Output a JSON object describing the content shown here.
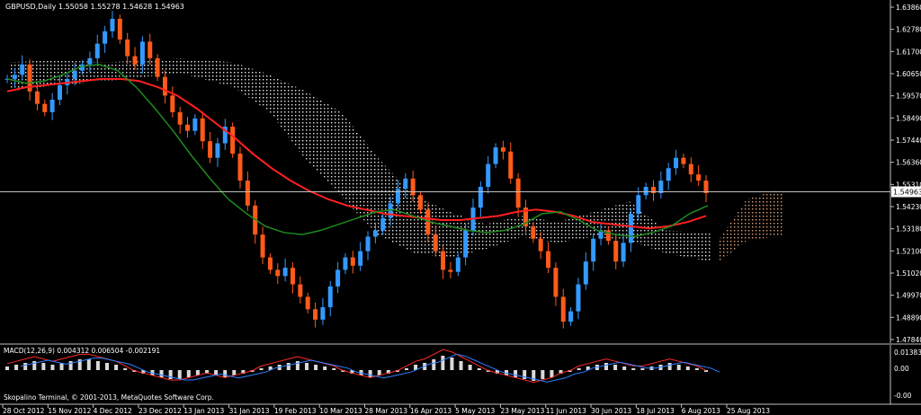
{
  "chart_data": [
    {
      "type": "candlestick",
      "title": "GBPUSD,Daily  1.55058 1.55278 1.54628 1.54963",
      "footer": "Skopalino Terminal, © 2001-2013, MetaQuotes Software Corp.",
      "current_price_label": "1.54963",
      "current_price": 1.54963,
      "ylim": [
        1.4784,
        1.6386
      ],
      "y_ticks": [
        "1.63860",
        "1.62780",
        "1.61700",
        "1.60650",
        "1.59570",
        "1.58490",
        "1.57440",
        "1.56360",
        "1.55310",
        "1.54230",
        "1.53180",
        "1.52100",
        "1.51020",
        "1.49970",
        "1.48890",
        "1.47840"
      ],
      "x_ticks": [
        "28 Oct 2012",
        "15 Nov 2012",
        "4 Dec 2012",
        "23 Dec 2012",
        "13 Jan 2013",
        "31 Jan 2013",
        "19 Feb 2013",
        "10 Mar 2013",
        "28 Mar 2013",
        "16 Apr 2013",
        "5 May 2013",
        "23 May 2013",
        "11 Jun 2013",
        "30 Jun 2013",
        "18 Jul 2013",
        "6 Aug 2013",
        "25 Aug 2013"
      ],
      "close_path": [
        1.604,
        1.606,
        1.611,
        1.598,
        1.592,
        1.588,
        1.594,
        1.601,
        1.604,
        1.608,
        1.611,
        1.614,
        1.621,
        1.627,
        1.633,
        1.623,
        1.615,
        1.611,
        1.622,
        1.614,
        1.605,
        1.596,
        1.588,
        1.582,
        1.579,
        1.585,
        1.574,
        1.566,
        1.573,
        1.581,
        1.568,
        1.555,
        1.543,
        1.529,
        1.518,
        1.512,
        1.509,
        1.513,
        1.505,
        1.499,
        1.493,
        1.488,
        1.494,
        1.504,
        1.512,
        1.518,
        1.514,
        1.521,
        1.528,
        1.531,
        1.537,
        1.544,
        1.551,
        1.556,
        1.548,
        1.541,
        1.529,
        1.521,
        1.512,
        1.511,
        1.518,
        1.531,
        1.542,
        1.552,
        1.563,
        1.571,
        1.569,
        1.556,
        1.542,
        1.533,
        1.527,
        1.521,
        1.513,
        1.499,
        1.487,
        1.492,
        1.505,
        1.516,
        1.527,
        1.531,
        1.526,
        1.516,
        1.525,
        1.539,
        1.548,
        1.552,
        1.549,
        1.555,
        1.561,
        1.566,
        1.563,
        1.558,
        1.555,
        1.549
      ],
      "series": [
        {
          "name": "MA red",
          "color": "#ff2020",
          "values": [
            1.598,
            1.6,
            1.601,
            1.602,
            1.603,
            1.604,
            1.604,
            1.603,
            1.6,
            1.596,
            1.59,
            1.583,
            1.576,
            1.568,
            1.561,
            1.555,
            1.55,
            1.546,
            1.543,
            1.541,
            1.539,
            1.538,
            1.537,
            1.536,
            1.536,
            1.537,
            1.538,
            1.54,
            1.541,
            1.54,
            1.538,
            1.535,
            1.534,
            1.533,
            1.532,
            1.533,
            1.535,
            1.538
          ]
        },
        {
          "name": "MA green",
          "color": "#1f8a1f",
          "values": [
            1.604,
            1.602,
            1.603,
            1.606,
            1.61,
            1.611,
            1.608,
            1.6,
            1.59,
            1.579,
            1.567,
            1.556,
            1.546,
            1.539,
            1.533,
            1.53,
            1.529,
            1.531,
            1.534,
            1.537,
            1.54,
            1.541,
            1.538,
            1.535,
            1.533,
            1.531,
            1.53,
            1.531,
            1.534,
            1.539,
            1.54,
            1.536,
            1.531,
            1.529,
            1.528,
            1.53,
            1.533,
            1.539,
            1.543
          ]
        }
      ]
    },
    {
      "type": "histogram",
      "title": "MACD(12,26,9) 0.004312 0.006504 -0.002191",
      "ylim": [
        -0.01,
        0.013834
      ],
      "y_ticks": [
        "0.013834",
        "0.00",
        "-0.00"
      ],
      "values": [
        0.002,
        0.003,
        0.004,
        0.005,
        0.004,
        0.003,
        0.004,
        0.005,
        0.006,
        0.006,
        0.005,
        0.004,
        0.003,
        0.001,
        -0.001,
        -0.002,
        -0.003,
        -0.004,
        -0.005,
        -0.005,
        -0.004,
        -0.003,
        -0.002,
        -0.003,
        -0.004,
        -0.003,
        -0.002,
        -0.001,
        0.001,
        0.002,
        0.003,
        0.004,
        0.005,
        0.004,
        0.003,
        0.002,
        0.001,
        -0.001,
        -0.002,
        -0.003,
        -0.004,
        -0.003,
        -0.002,
        -0.001,
        0.001,
        0.003,
        0.004,
        0.006,
        0.008,
        0.007,
        0.005,
        0.003,
        0.001,
        -0.001,
        -0.002,
        -0.003,
        -0.004,
        -0.005,
        -0.006,
        -0.005,
        -0.004,
        -0.002,
        -0.001,
        0.001,
        0.002,
        0.003,
        0.004,
        0.003,
        0.002,
        0.001,
        0.001,
        0.002,
        0.003,
        0.004,
        0.003,
        0.002,
        0.001,
        -0.001
      ]
    }
  ]
}
